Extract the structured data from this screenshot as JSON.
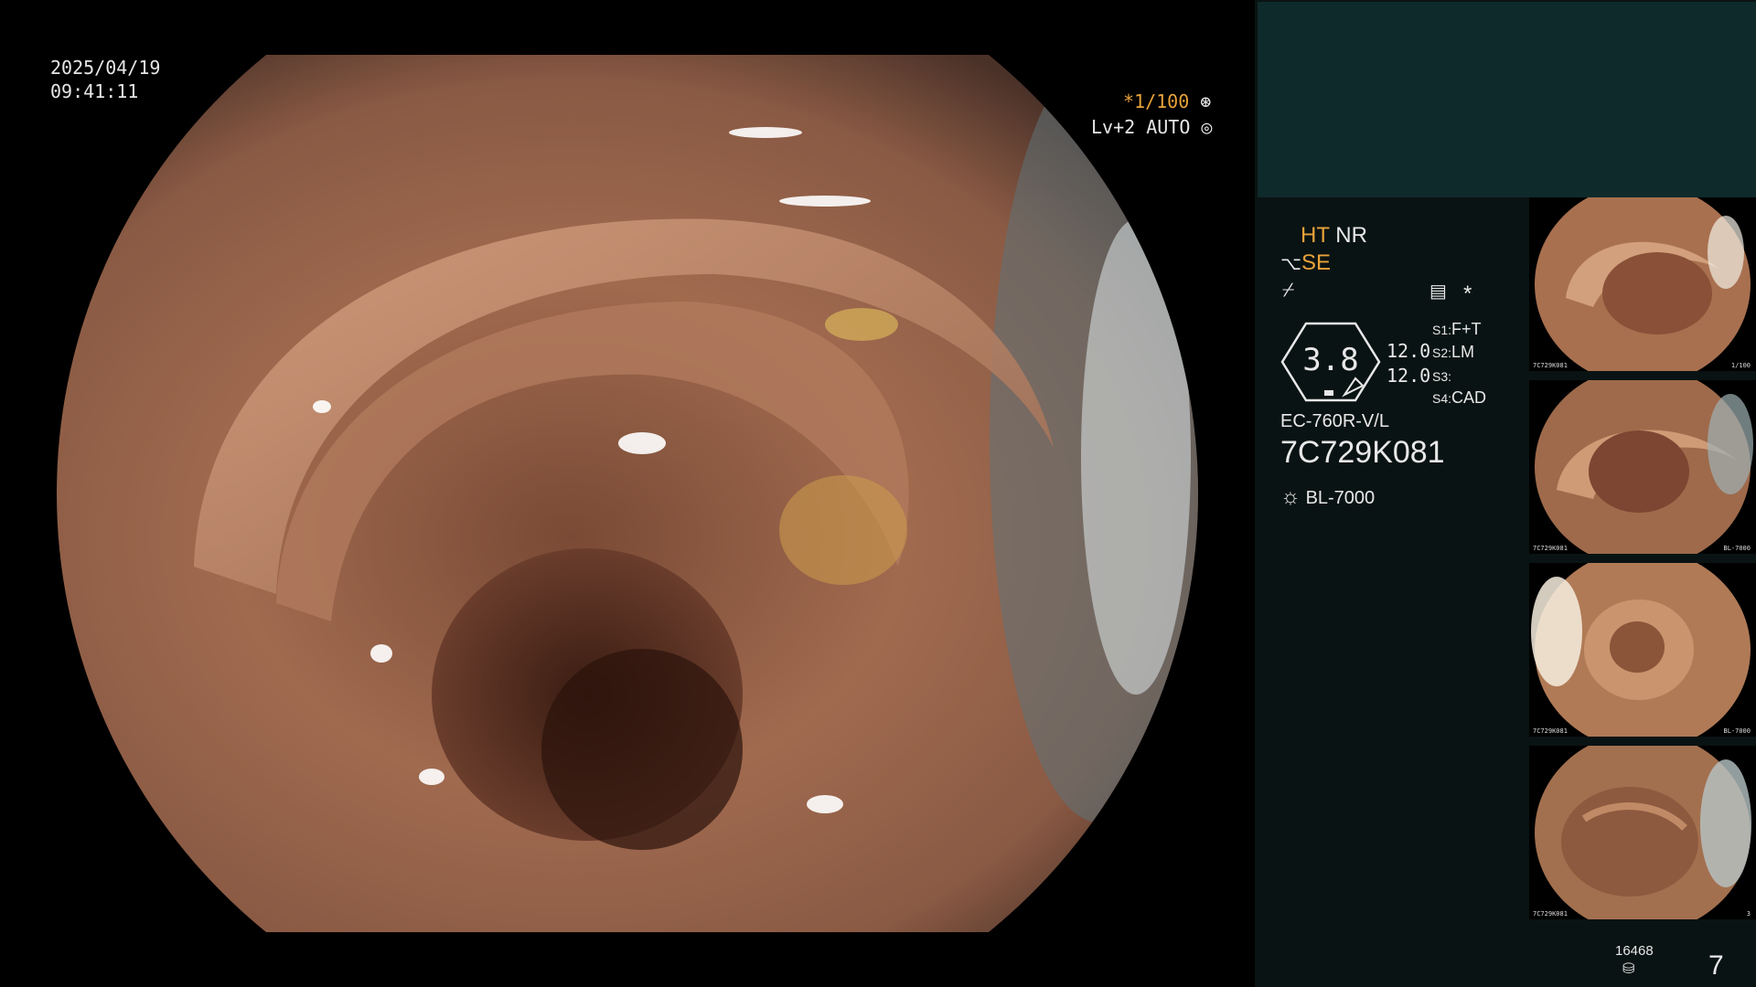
{
  "osd": {
    "date": "2025/04/19",
    "time": "09:41:11",
    "shutter": "*1/100",
    "iris": "Lv+2 AUTO"
  },
  "status": {
    "ht": "HT",
    "nr": "NR",
    "se": "SE",
    "zoom_value": "3.8",
    "val1": "12.0",
    "val2": "12.0",
    "s1_key": "S1:",
    "s1_val": "F+T",
    "s2_key": "S2:",
    "s2_val": "LM",
    "s3_key": "S3:",
    "s3_val": "",
    "s4_key": "S4:",
    "s4_val": "CAD",
    "asterisk": "*",
    "scope_model": "EC-760R-V/L",
    "serial": "7C729K081",
    "light_source": "BL-7000",
    "counter": "16468",
    "capture_count": "7"
  },
  "thumbnails": [
    {
      "id": "capture-1",
      "label": "7C729K081",
      "scale": "1/100"
    },
    {
      "id": "capture-2",
      "label": "7C729K081",
      "scale": "BL-7000"
    },
    {
      "id": "capture-3",
      "label": "7C729K081",
      "scale": "BL-7000"
    },
    {
      "id": "capture-4",
      "label": "7C729K081",
      "scale": "3"
    }
  ],
  "colors": {
    "accent_amber": "#e8a23a",
    "panel_bg": "#0a1313",
    "panel_top_bg": "#0f2a2b"
  },
  "icons": [
    "shutter-aperture-icon",
    "iris-icon",
    "settings-sliders-icon",
    "se-tool-icon",
    "freeze-icon",
    "light-source-icon",
    "storage-disk-icon"
  ]
}
